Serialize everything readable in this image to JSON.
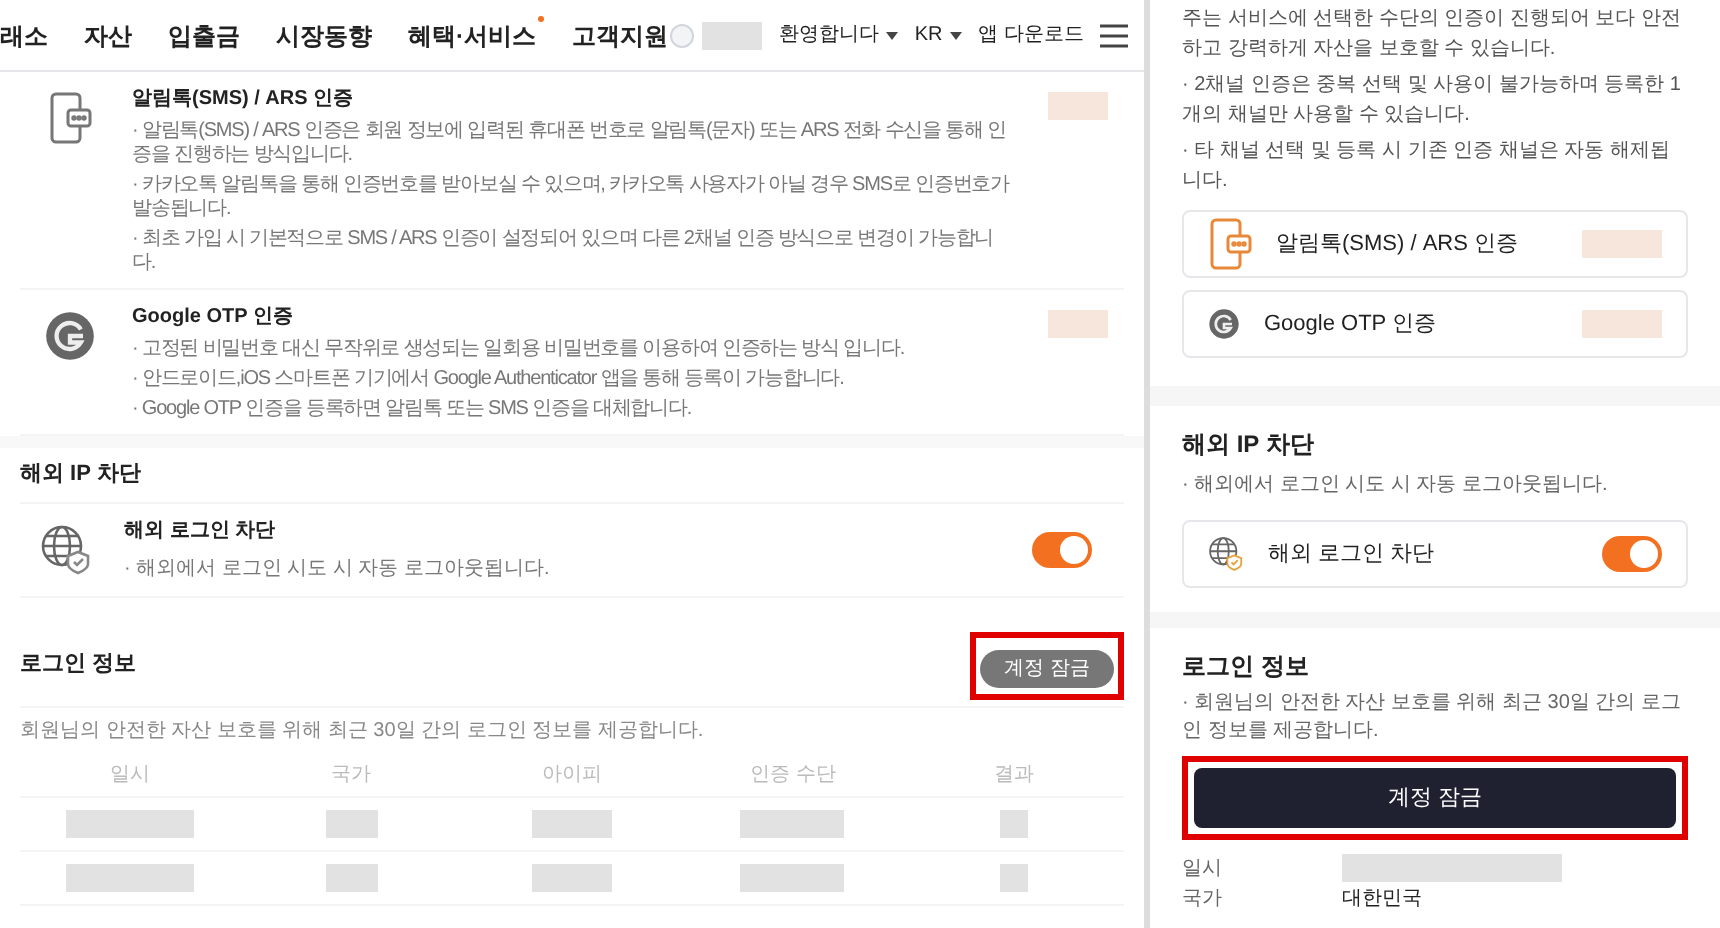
{
  "desktop": {
    "nav": {
      "items": [
        {
          "label": "래소",
          "dot": false
        },
        {
          "label": "자산",
          "dot": false
        },
        {
          "label": "입출금",
          "dot": false
        },
        {
          "label": "시장동향",
          "dot": false
        },
        {
          "label": "혜택·서비스",
          "dot": true
        },
        {
          "label": "고객지원",
          "dot": false
        }
      ],
      "welcome": "환영합니다",
      "language": "KR",
      "app_download": "앱 다운로드"
    },
    "auth_methods": [
      {
        "kind": "sms",
        "title": "알림톡(SMS) / ARS 인증",
        "notes": [
          "· 알림톡(SMS) / ARS 인증은 회원 정보에 입력된 휴대폰 번호로 알림톡(문자) 또는 ARS 전화 수신을 통해 인증을 진행하는 방식입니다.",
          "· 카카오톡 알림톡을 통해 인증번호를 받아보실 수 있으며, 카카오톡 사용자가 아닐 경우 SMS로 인증번호가 발송됩니다.",
          "· 최초 가입 시 기본적으로 SMS / ARS 인증이 설정되어 있으며 다른 2채널 인증 방식으로 변경이 가능합니다."
        ]
      },
      {
        "kind": "otp",
        "title": "Google OTP 인증",
        "notes": [
          "· 고정된 비밀번호 대신 무작위로 생성되는 일회용 비밀번호를 이용하여 인증하는 방식 입니다.",
          "· 안드로이드,iOS 스마트폰 기기에서 Google Authenticator 앱을 통해 등록이 가능합니다.",
          "· Google OTP 인증을 등록하면 알림톡 또는 SMS 인증을 대체합니다."
        ]
      }
    ],
    "ip_block": {
      "title": "해외 IP 차단",
      "label": "해외 로그인 차단",
      "note": "· 해외에서 로그인 시도 시 자동 로그아웃됩니다.",
      "on": true
    },
    "login_info": {
      "title": "로그인 정보",
      "lock_button": "계정 잠금",
      "highlighted": true,
      "description": "회원님의 안전한 자산 보호를 위해 최근 30일 간의 로그인 정보를 제공합니다.",
      "columns": [
        "일시",
        "국가",
        "아이피",
        "인증 수단",
        "결과"
      ]
    }
  },
  "mobile": {
    "intro": [
      "주는 서비스에 선택한 수단의 인증이 진행되어 보다 안전하고 강력하게 자산을 보호할 수 있습니다.",
      "· 2채널 인증은 중복 선택 및 사용이 불가능하며 등록한 1개의 채널만 사용할 수 있습니다.",
      "· 타 채널 선택 및 등록 시 기존 인증 채널은 자동 해제됩니다."
    ],
    "auth_methods": [
      {
        "kind": "sms",
        "title": "알림톡(SMS) / ARS 인증"
      },
      {
        "kind": "otp",
        "title": "Google OTP 인증"
      }
    ],
    "ip_block": {
      "title": "해외 IP 차단",
      "note": "· 해외에서 로그인 시도 시 자동 로그아웃됩니다.",
      "label": "해외 로그인 차단",
      "on": true
    },
    "login_info": {
      "title": "로그인 정보",
      "description": "· 회원님의 안전한 자산 보호를 위해 최근 30일 간의 로그인 정보를 제공합니다.",
      "lock_button": "계정 잠금",
      "highlighted": true,
      "fields": [
        {
          "label": "일시"
        },
        {
          "label": "국가",
          "value": "대한민국"
        }
      ]
    }
  }
}
